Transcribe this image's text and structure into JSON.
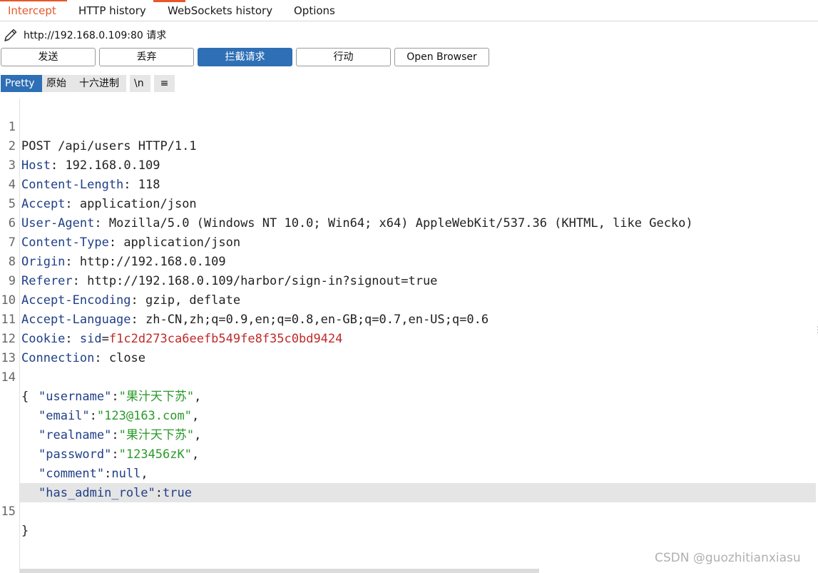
{
  "tabs": [
    {
      "label": "Intercept",
      "active": true
    },
    {
      "label": "HTTP history",
      "active": false
    },
    {
      "label": "WebSockets history",
      "active": false
    },
    {
      "label": "Options",
      "active": false
    }
  ],
  "request": {
    "url_label": "http://192.168.0.109:80 请求",
    "icon": "pencil-icon"
  },
  "actions": {
    "forward": "发送",
    "drop": "丢弃",
    "intercept": "拦截请求",
    "action": "行动",
    "open_browser": "Open Browser"
  },
  "view_modes": {
    "pretty": "Pretty",
    "raw": "原始",
    "hex": "十六进制",
    "newline": "\\n",
    "menu": "≡"
  },
  "request_lines": [
    {
      "n": "1",
      "key": "",
      "sep": "",
      "value": "POST /api/users HTTP/1.1"
    },
    {
      "n": "2",
      "key": "Host",
      "sep": ": ",
      "value": "192.168.0.109"
    },
    {
      "n": "3",
      "key": "Content-Length",
      "sep": ": ",
      "value": "118"
    },
    {
      "n": "4",
      "key": "Accept",
      "sep": ": ",
      "value": "application/json"
    },
    {
      "n": "5",
      "key": "User-Agent",
      "sep": ": ",
      "value": "Mozilla/5.0 (Windows NT 10.0; Win64; x64) AppleWebKit/537.36 (KHTML, like Gecko)"
    },
    {
      "n": "6",
      "key": "Content-Type",
      "sep": ": ",
      "value": "application/json"
    },
    {
      "n": "7",
      "key": "Origin",
      "sep": ": ",
      "value": "http://192.168.0.109"
    },
    {
      "n": "8",
      "key": "Referer",
      "sep": ": ",
      "value": "http://192.168.0.109/harbor/sign-in?signout=true"
    },
    {
      "n": "9",
      "key": "Accept-Encoding",
      "sep": ": ",
      "value": "gzip, deflate"
    },
    {
      "n": "10",
      "key": "Accept-Language",
      "sep": ": ",
      "value": "zh-CN,zh;q=0.9,en;q=0.8,en-GB;q=0.7,en-US;q=0.6"
    }
  ],
  "cookie_line": {
    "n": "11",
    "key": "Cookie",
    "sep": ": ",
    "cookie_name": "sid",
    "eq": "=",
    "cookie_value": "f1c2d273ca6eefb549fe8f35c0bd9424"
  },
  "connection_line": {
    "n": "12",
    "key": "Connection",
    "sep": ": ",
    "value": "close"
  },
  "empty_line": {
    "n": "13"
  },
  "body_open": {
    "n": "14",
    "text": "{"
  },
  "body_fields": [
    {
      "key": "\"username\"",
      "colon": ":",
      "value": "\"果汁天下苏\"",
      "comma": ",",
      "type": "string"
    },
    {
      "key": "\"email\"",
      "colon": ":",
      "value": "\"123@163.com\"",
      "comma": ",",
      "type": "string"
    },
    {
      "key": "\"realname\"",
      "colon": ":",
      "value": "\"果汁天下苏\"",
      "comma": ",",
      "type": "string"
    },
    {
      "key": "\"password\"",
      "colon": ":",
      "value": "\"123456zK\"",
      "comma": ",",
      "type": "string"
    },
    {
      "key": "\"comment\"",
      "colon": ":",
      "value": "null",
      "comma": ",",
      "type": "literal"
    },
    {
      "key": "\"has_admin_role\"",
      "colon": ":",
      "value": "true",
      "comma": "",
      "type": "literal"
    }
  ],
  "body_close": {
    "n": "15",
    "text": "}"
  },
  "watermark": "CSDN @guozhitianxiasu",
  "colors": {
    "accent_tab": "#e8572a",
    "primary_button": "#2e6fb5",
    "header_key": "#1f3f86",
    "json_string": "#2a9a2a",
    "cookie_value": "#c02929"
  }
}
